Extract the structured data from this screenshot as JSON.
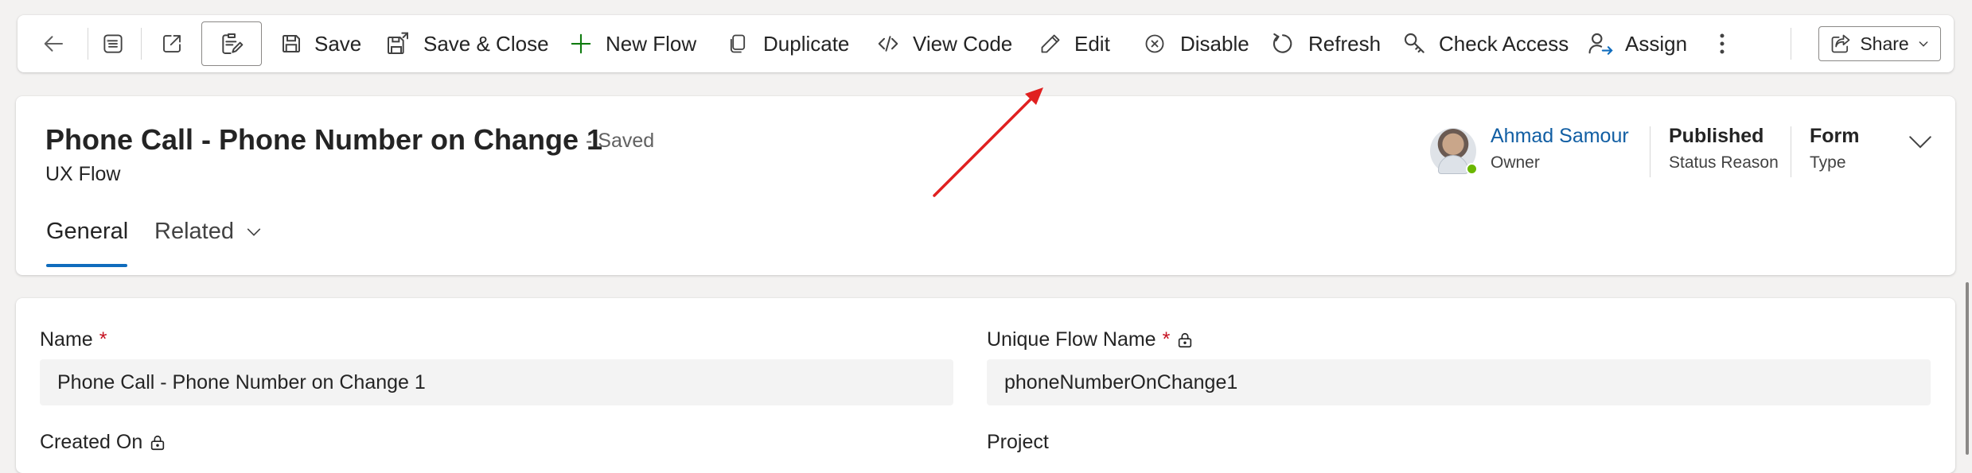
{
  "command_bar": {
    "save": "Save",
    "save_close": "Save & Close",
    "new_flow": "New Flow",
    "duplicate": "Duplicate",
    "view_code": "View Code",
    "edit": "Edit",
    "disable": "Disable",
    "refresh": "Refresh",
    "check_access": "Check Access",
    "assign": "Assign",
    "share": "Share"
  },
  "header": {
    "title": "Phone Call - Phone Number on Change 1",
    "saved_status": "- Saved",
    "entity": "UX Flow",
    "owner_name": "Ahmad Samour",
    "owner_label": "Owner",
    "status_reason_value": "Published",
    "status_reason_label": "Status Reason",
    "type_value": "Form",
    "type_label": "Type",
    "tabs": [
      {
        "label": "General",
        "selected": true
      },
      {
        "label": "Related",
        "selected": false
      }
    ]
  },
  "form": {
    "name_label": "Name",
    "name_value": "Phone Call - Phone Number on Change 1",
    "unique_label": "Unique Flow Name",
    "unique_value": "phoneNumberOnChange1",
    "created_on_label": "Created On",
    "project_label": "Project",
    "required_marker": "*"
  },
  "colors": {
    "accent": "#0f6cbd",
    "link": "#115ea3",
    "required": "#c50f1f",
    "annotation_arrow": "#e02020",
    "presence_available": "#6bb700"
  },
  "icons": [
    "back-arrow-icon",
    "form-icon",
    "open-new-window-icon",
    "edit-form-icon",
    "save-icon",
    "save-close-icon",
    "plus-icon",
    "duplicate-icon",
    "code-icon",
    "pencil-icon",
    "disable-icon",
    "refresh-icon",
    "check-access-icon",
    "assign-icon",
    "more-icon",
    "share-icon",
    "chevron-down-icon",
    "lock-icon"
  ]
}
